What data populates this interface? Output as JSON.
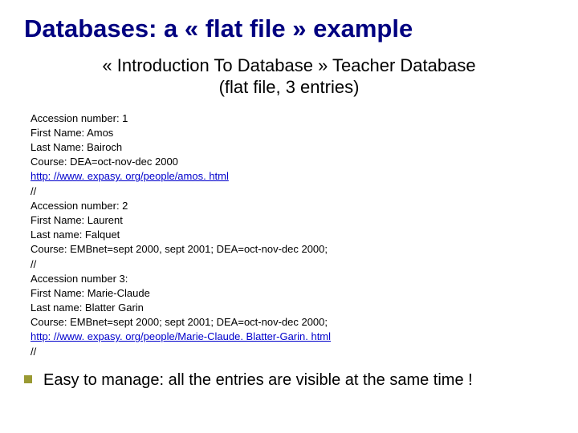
{
  "title": "Databases: a « flat file » example",
  "subtitle_line1": "« Introduction To Database » Teacher Database",
  "subtitle_line2": "(flat file, 3 entries)",
  "records": {
    "r1": {
      "acc": "Accession number: 1",
      "fn": "First Name: Amos",
      "ln": "Last Name: Bairoch",
      "course": "Course: DEA=oct-nov-dec 2000",
      "url": "http: //www. expasy. org/people/amos. html",
      "sep": "//"
    },
    "r2": {
      "acc": "Accession number: 2",
      "fn": "First Name: Laurent",
      "ln": "Last name: Falquet",
      "course": "Course: EMBnet=sept 2000, sept 2001; DEA=oct-nov-dec 2000;",
      "sep": "//"
    },
    "r3": {
      "acc": "Accession number 3:",
      "fn": "First Name: Marie-Claude",
      "ln": "Last name: Blatter Garin",
      "course": "Course: EMBnet=sept 2000; sept 2001; DEA=oct-nov-dec 2000;",
      "url": "http: //www. expasy. org/people/Marie-Claude. Blatter-Garin. html",
      "sep": "//"
    }
  },
  "bullet": "Easy to manage: all the entries are visible at the same time !"
}
